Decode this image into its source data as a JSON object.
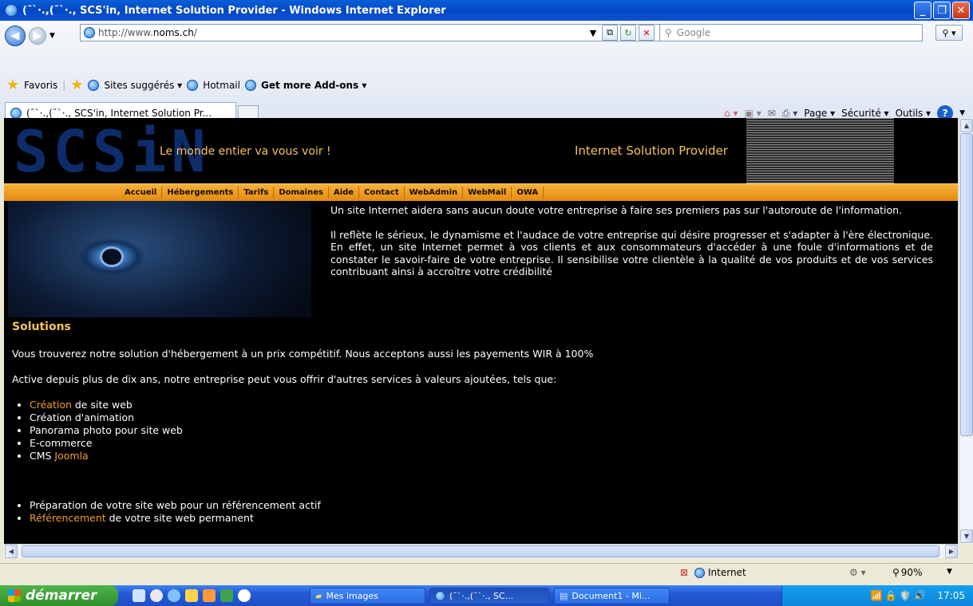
{
  "window": {
    "title": "(¯`·.,(¯`·., SCS'in, Internet Solution Provider - Windows Internet Explorer"
  },
  "address": {
    "prefix": "http://www.",
    "domain": "noms.ch",
    "suffix": "/"
  },
  "search": {
    "placeholder": "Google"
  },
  "favorites": {
    "label": "Favoris",
    "items": [
      "Sites suggérés ▾",
      "Hotmail",
      "Get more Add-ons ▾"
    ]
  },
  "tab": {
    "label": "(¯`·.,(¯`·., SCS'in, Internet Solution Pr..."
  },
  "commandbar": {
    "page": "Page ▾",
    "security": "Sécurité ▾",
    "tools": "Outils ▾"
  },
  "site": {
    "logo": "SCSiN",
    "slogan": "Le monde entier va vous voir !",
    "tagline": "Internet Solution Provider",
    "menu": [
      "Accueil",
      "Hébergements",
      "Tarifs",
      "Domaines",
      "Aide",
      "Contact",
      "WebAdmin",
      "WebMail",
      "OWA"
    ],
    "intro": [
      "Un site Internet aidera sans aucun doute votre entreprise à faire ses premiers pas sur l'autoroute de l'information.",
      "Il reflète le sérieux, le dynamisme et l'audace de votre entreprise qui désire progresser et s'adapter à l'ère électronique. En effet, un site Internet permet à vos clients et aux consommateurs d'accéder à une foule d'informations et de constater le savoir-faire de votre entreprise. Il sensibilise votre clientèle à la qualité de vos produits et de vos services contribuant ainsi à accroître votre crédibilité"
    ],
    "solutions_heading": "Solutions",
    "solutions_p1": "Vous trouverez notre solution d'hébergement à un prix compétitif. Nous acceptons aussi les payements WIR à 100%",
    "solutions_p2": "Active depuis plus de dix ans, notre entreprise peut vous offrir d'autres services à valeurs ajoutées, tels que:",
    "list1": {
      "creation_link": "Création",
      "creation_rest": " de site web",
      "item2": "Création d'animation",
      "item3": "Panorama photo pour site web",
      "item4": "E-commerce",
      "cms_prefix": "CMS ",
      "cms_link": "Joomla"
    },
    "list2": {
      "item1": "Préparation de votre site web pour un référencement actif",
      "ref_link": "Référencement",
      "ref_rest": " de votre site web permanent"
    }
  },
  "status": {
    "zone": "Internet",
    "zoom": "90%"
  },
  "taskbar": {
    "start": "démarrer",
    "items": [
      "Mes images",
      "(¯`·.,(¯`·., SC...",
      "Document1 - Mi..."
    ],
    "clock": "17:05"
  }
}
